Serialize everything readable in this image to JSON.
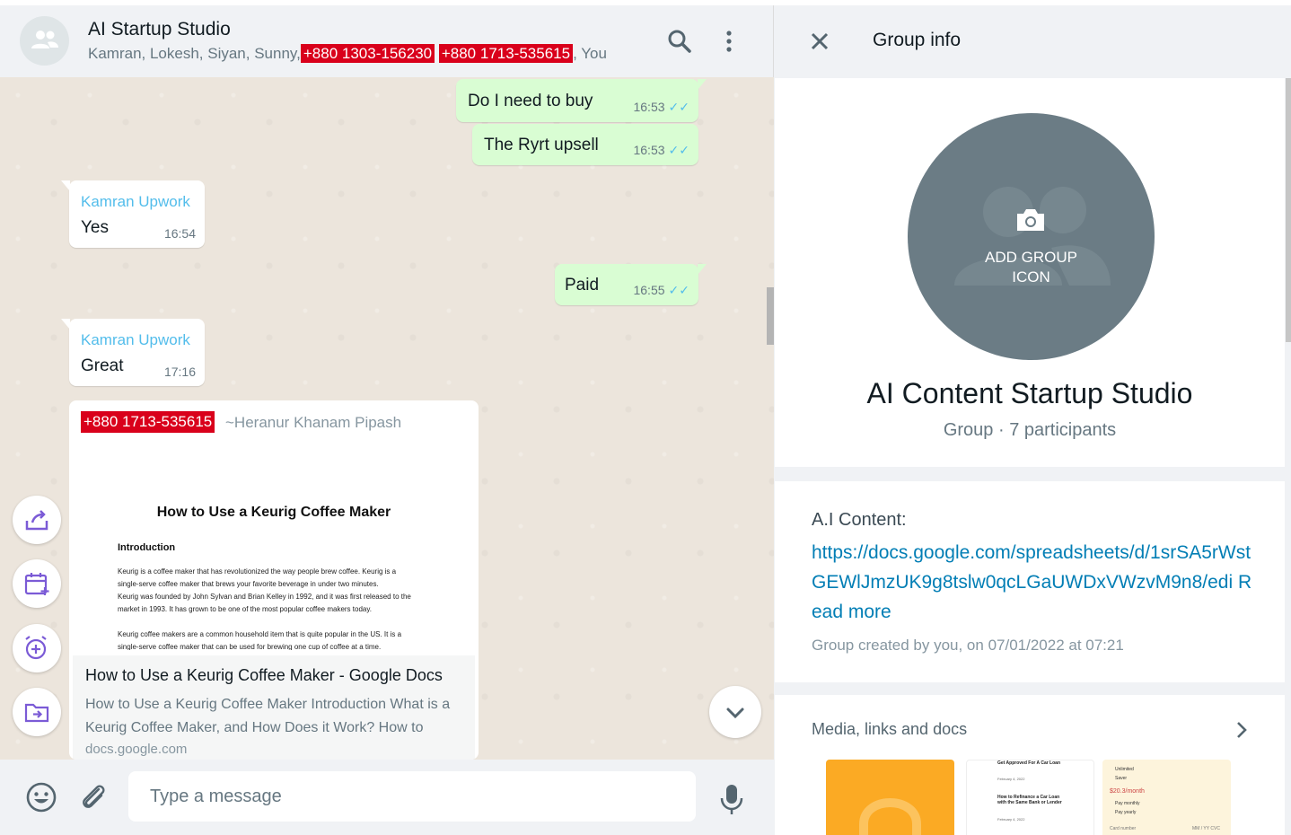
{
  "chat": {
    "title": "AI Startup Studio",
    "members_prefix": "Kamran, Lokesh, Siyan, Sunny,",
    "member_phone_1": "+880 1303-156230",
    "member_phone_2": "+880 1713-535615",
    "members_suffix": ", You",
    "messages": [
      {
        "text": "Do I need to buy",
        "time": "16:53"
      },
      {
        "text": "The Ryrt upsell",
        "time": "16:53"
      },
      {
        "sender": "Kamran Upwork",
        "text": "Yes",
        "time": "16:54"
      },
      {
        "text": "Paid",
        "time": "16:55"
      },
      {
        "sender": "Kamran Upwork",
        "text": "Great",
        "time": "17:16"
      }
    ],
    "doc_message": {
      "sender_phone": "+880 1713-535615",
      "sender_name": "~Heranur Khanam Pipash",
      "preview_title": "How to Use a Keurig Coffee Maker",
      "preview_heading": "Introduction",
      "preview_lines": [
        "Keurig is a coffee maker that has revolutionized the way people brew coffee. Keurig is a",
        "single-serve coffee maker that brews your favorite beverage in under two minutes.",
        "Keurig was founded by John Sylvan and Brian Kelley in 1992, and it was first released to the",
        "market in 1993. It has grown to be one of the most popular coffee makers today.",
        "Keurig coffee makers are a common household item that is quite popular in the US. It is a",
        "single-serve coffee maker that can be used for brewing one cup of coffee at a time."
      ],
      "link_title": "How to Use a Keurig Coffee Maker - Google Docs",
      "link_desc": "How to Use a Keurig Coffee Maker Introduction What is a Keurig Coffee Maker, and How Does it Work? How to",
      "link_domain": "docs.google.com"
    },
    "composer_placeholder": "Type a message"
  },
  "info": {
    "header_title": "Group info",
    "add_icon_label": "ADD GROUP ICON",
    "group_name": "AI Content Startup Studio",
    "group_sub": "Group · 7 participants",
    "desc_label": "A.I Content:",
    "desc_link": "https://docs.google.com/spreadsheets/d/1srSA5rWstGEWlJmzUK9g8tslw0qcLGaUWDxVWzvM9n8/edi",
    "read_more": "Read more",
    "created": "Group created by you, on 07/01/2022 at 07:21",
    "media_label": "Media, links and docs",
    "thumb2_lines": [
      "Get Approved For A Car Loan",
      "February 4, 2022",
      "How to Refinance a Car Loan with the Same Bank or Lender",
      "February 4, 2022"
    ],
    "thumb3_lines": [
      "Unlimited",
      "Saver",
      "$20.3/month",
      "Pay monthly",
      "Pay yearly",
      "Card number",
      "MM / YY  CVC"
    ]
  },
  "colors": {
    "outgoing_bubble": "#d9fdd3",
    "sender_name": "#53bdeb",
    "phone_highlight": "#d9001b",
    "link": "#027eb5",
    "group_icon_bg": "#6b7c85"
  }
}
